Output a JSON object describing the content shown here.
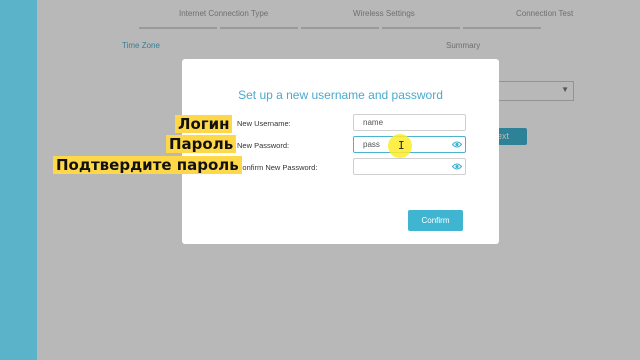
{
  "wizard": {
    "steps": [
      "Internet Connection Type",
      "Wireless Settings",
      "Connection Test"
    ],
    "sub_steps": [
      "Time Zone",
      "Summary"
    ],
    "next_label": "ext"
  },
  "modal": {
    "title": "Set up a new username and password",
    "fields": [
      {
        "label": "New Username:",
        "value": "name"
      },
      {
        "label": "New Password:",
        "value": "pass"
      },
      {
        "label": "Confirm New Password:",
        "value": ""
      }
    ],
    "confirm_label": "Confirm"
  },
  "captions": [
    "Логин",
    "Пароль",
    "Подтвердите пароль"
  ],
  "colors": {
    "accent": "#3fb5d2",
    "highlight": "#ffd84a",
    "sidebar": "#5bb3c9"
  }
}
